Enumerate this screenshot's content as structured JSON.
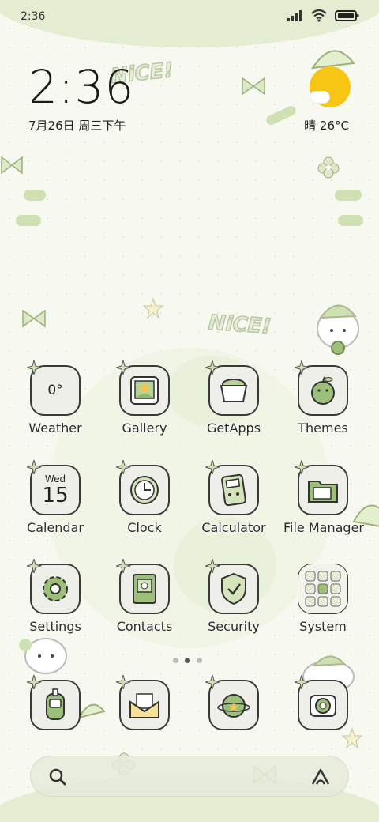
{
  "status_bar": {
    "time": "2:36"
  },
  "clock_widget": {
    "time": "2:36",
    "date": "7月26日 周三下午",
    "weather": "晴 26°C"
  },
  "decor": {
    "nice_text_1": "NiCE!",
    "nice_text_2": "NiCE!"
  },
  "apps": [
    {
      "id": "weather",
      "label": "Weather",
      "icon_text": "0°"
    },
    {
      "id": "gallery",
      "label": "Gallery"
    },
    {
      "id": "getapps",
      "label": "GetApps"
    },
    {
      "id": "themes",
      "label": "Themes"
    },
    {
      "id": "calendar",
      "label": "Calendar",
      "icon_day": "Wed",
      "icon_date": "15"
    },
    {
      "id": "clock",
      "label": "Clock"
    },
    {
      "id": "calculator",
      "label": "Calculator"
    },
    {
      "id": "file-manager",
      "label": "File Manager"
    },
    {
      "id": "settings",
      "label": "Settings"
    },
    {
      "id": "contacts",
      "label": "Contacts"
    },
    {
      "id": "security",
      "label": "Security"
    },
    {
      "id": "system",
      "label": "System"
    }
  ],
  "page_indicator": {
    "pages": 3,
    "current": 2
  },
  "dock": [
    {
      "id": "phone",
      "icon": "walkie-phone-icon"
    },
    {
      "id": "messages",
      "icon": "envelope-icon"
    },
    {
      "id": "browser",
      "icon": "apple-planet-icon"
    },
    {
      "id": "camera",
      "icon": "camera-icon"
    }
  ],
  "search_bar": {
    "left_icon": "search-icon",
    "right_icon": "assistant-icon"
  },
  "colors": {
    "accent_green": "#9cc07a",
    "sun": "#f7c514",
    "outline": "#3a3a3a"
  }
}
